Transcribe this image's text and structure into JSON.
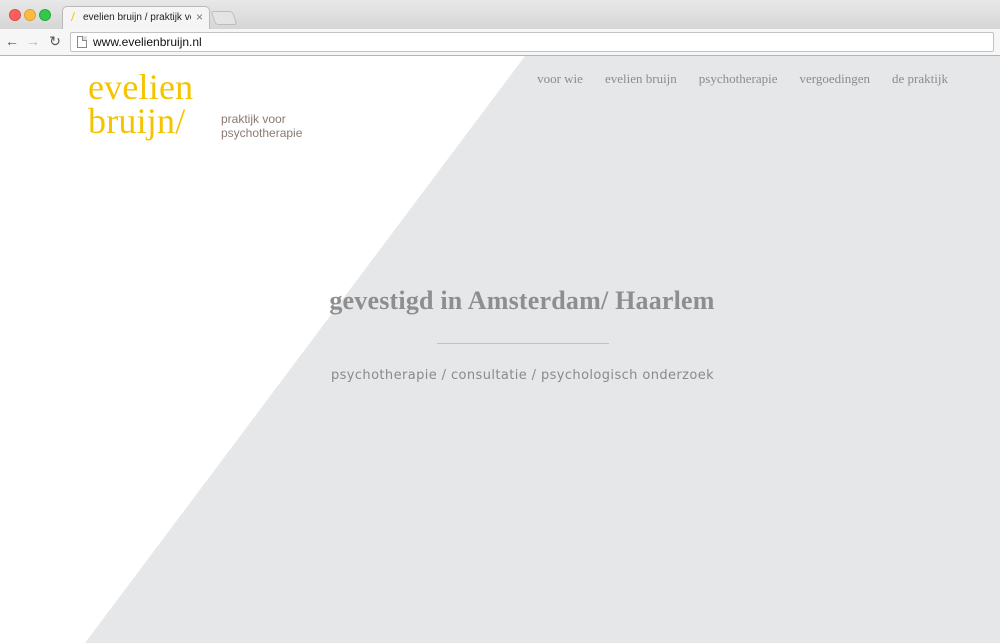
{
  "browser": {
    "tab_title": "evelien bruijn / praktijk voor psychotherapie",
    "tab_favicon": "/",
    "tab_close": "×",
    "url": "www.evelienbruijn.nl"
  },
  "logo": {
    "line1": "evelien",
    "line2": "bruijn/",
    "tagline1": "praktijk voor",
    "tagline2": "psychotherapie"
  },
  "nav": {
    "items": [
      "voor wie",
      "evelien bruijn",
      "psychotherapie",
      "vergoedingen",
      "de praktijk"
    ]
  },
  "hero": {
    "title": "gevestigd in Amsterdam/ Haarlem",
    "subtitle": "psychotherapie / consultatie / psychologisch onderzoek"
  },
  "colors": {
    "accent": "#f5c400",
    "background_panel": "#e6e7e9",
    "text_gray": "#8e8e8e"
  },
  "icons": [
    "back-arrow-icon",
    "forward-arrow-icon",
    "reload-icon",
    "page-icon",
    "close-icon"
  ]
}
